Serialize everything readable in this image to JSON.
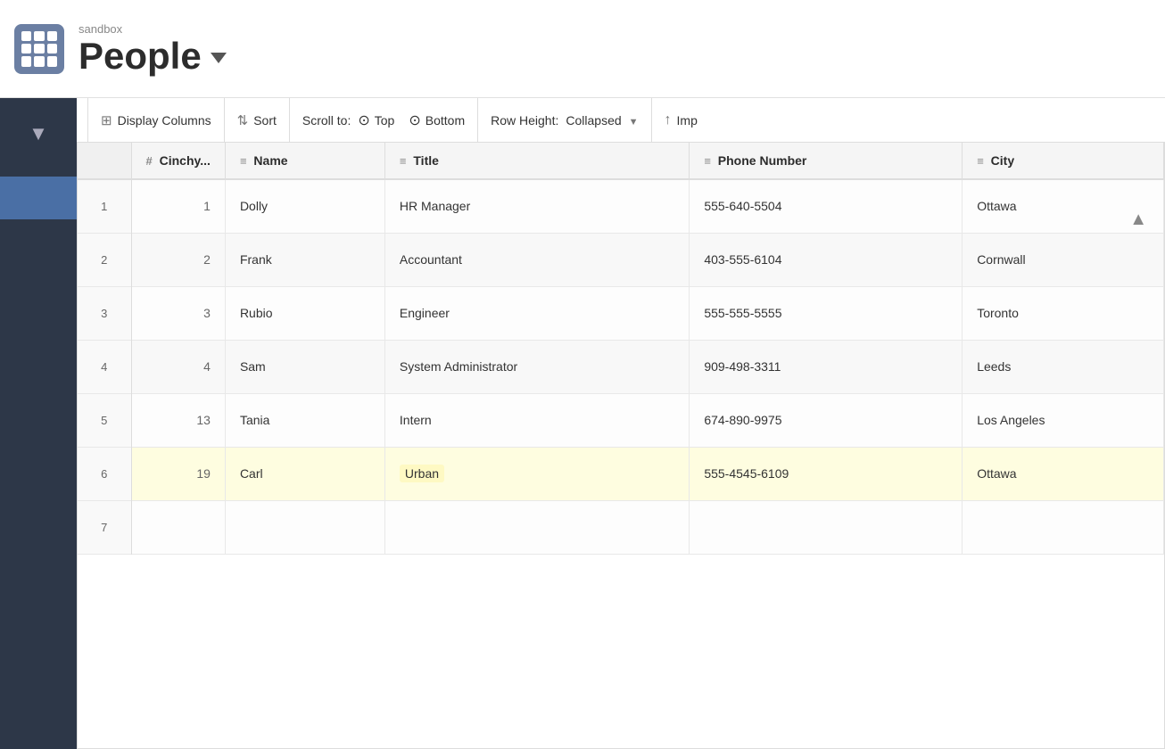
{
  "app": {
    "subtitle": "sandbox",
    "title": "People",
    "logo_alt": "grid-logo"
  },
  "toolbar": {
    "display_columns_label": "Display Columns",
    "sort_label": "Sort",
    "scroll_to_label": "Scroll to:",
    "top_label": "Top",
    "bottom_label": "Bottom",
    "row_height_label": "Row Height:",
    "collapsed_label": "Collapsed",
    "import_label": "Imp"
  },
  "table": {
    "columns": [
      {
        "id": "row-num",
        "label": ""
      },
      {
        "id": "cinchy",
        "label": "# Cinchy...",
        "icon": "≡"
      },
      {
        "id": "name",
        "label": "Name",
        "icon": "≡"
      },
      {
        "id": "title",
        "label": "Title",
        "icon": "≡"
      },
      {
        "id": "phone",
        "label": "Phone Number",
        "icon": "≡"
      },
      {
        "id": "city",
        "label": "City",
        "icon": "≡"
      }
    ],
    "rows": [
      {
        "rownum": 1,
        "cinchy": 1,
        "name": "Dolly",
        "title": "HR Manager",
        "phone": "555-640-5504",
        "city": "Ottawa",
        "highlighted": false
      },
      {
        "rownum": 2,
        "cinchy": 2,
        "name": "Frank",
        "title": "Accountant",
        "phone": "403-555-6104",
        "city": "Cornwall",
        "highlighted": false
      },
      {
        "rownum": 3,
        "cinchy": 3,
        "name": "Rubio",
        "title": "Engineer",
        "phone": "555-555-5555",
        "city": "Toronto",
        "highlighted": false
      },
      {
        "rownum": 4,
        "cinchy": 4,
        "name": "Sam",
        "title": "System Administrator",
        "phone": "909-498-3311",
        "city": "Leeds",
        "highlighted": false
      },
      {
        "rownum": 5,
        "cinchy": 13,
        "name": "Tania",
        "title": "Intern",
        "phone": "674-890-9975",
        "city": "Los Angeles",
        "highlighted": false
      },
      {
        "rownum": 6,
        "cinchy": 19,
        "name": "Carl",
        "title": "Urban",
        "phone": "555-4545-6109",
        "city": "Ottawa",
        "highlighted": true
      },
      {
        "rownum": 7,
        "cinchy": "",
        "name": "",
        "title": "",
        "phone": "",
        "city": "",
        "highlighted": false
      }
    ]
  },
  "colors": {
    "sidebar_bg": "#2d3748",
    "sidebar_active": "#4a6fa5",
    "header_bg": "#ffffff",
    "toolbar_bg": "#ffffff",
    "table_bg": "#ffffff",
    "highlight_bg": "#fefde0",
    "accent": "#4a6fa5"
  }
}
